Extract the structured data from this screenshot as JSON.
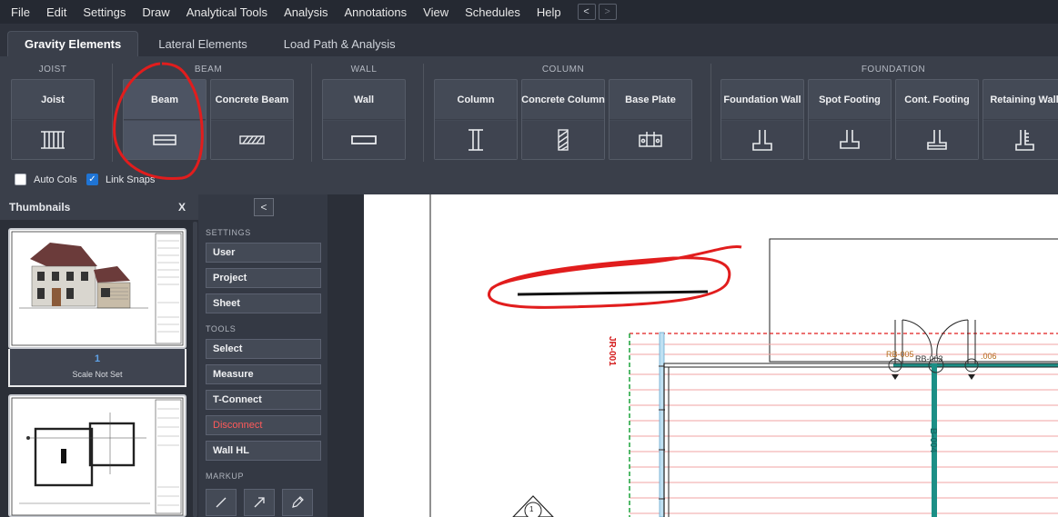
{
  "menu": {
    "items": [
      "File",
      "Edit",
      "Settings",
      "Draw",
      "Analytical Tools",
      "Analysis",
      "Annotations",
      "View",
      "Schedules",
      "Help"
    ],
    "back": "<",
    "forward": ">"
  },
  "tabs": [
    "Gravity Elements",
    "Lateral Elements",
    "Load Path & Analysis"
  ],
  "ribbon": {
    "groups": {
      "joist": "JOIST",
      "beam": "BEAM",
      "wall": "WALL",
      "column": "COLUMN",
      "foundation": "FOUNDATION"
    },
    "tools": {
      "joist": "Joist",
      "beam": "Beam",
      "concrete_beam": "Concrete Beam",
      "wall": "Wall",
      "column": "Column",
      "concrete_column": "Concrete Column",
      "base_plate": "Base Plate",
      "foundation_wall": "Foundation Wall",
      "spot_footing": "Spot Footing",
      "cont_footing": "Cont. Footing",
      "retaining_wall": "Retaining Wall"
    },
    "checks": {
      "auto_cols": "Auto Cols",
      "auto_cols_checked": false,
      "link_snaps": "Link Snaps",
      "link_snaps_checked": true
    }
  },
  "thumbnails": {
    "title": "Thumbnails",
    "close": "X",
    "pages": [
      {
        "number": "1",
        "scale": "Scale Not Set"
      }
    ]
  },
  "sidepanel": {
    "collapse": "<",
    "settings_label": "SETTINGS",
    "settings": [
      "User",
      "Project",
      "Sheet"
    ],
    "tools_label": "TOOLS",
    "tools": [
      "Select",
      "Measure",
      "T-Connect",
      "Disconnect",
      "Wall HL"
    ],
    "markup_label": "MARKUP"
  },
  "drawing": {
    "labels": {
      "jr001": "JR-001",
      "rb005": "RB-005",
      "rb006": ".006",
      "rb003": "RB-003",
      "b004": "B-004",
      "grid1": "1"
    }
  },
  "colors": {
    "accent_blue": "#1f74d4",
    "markup_red": "#e11d1d",
    "disconnect": "#ff5a5a"
  }
}
